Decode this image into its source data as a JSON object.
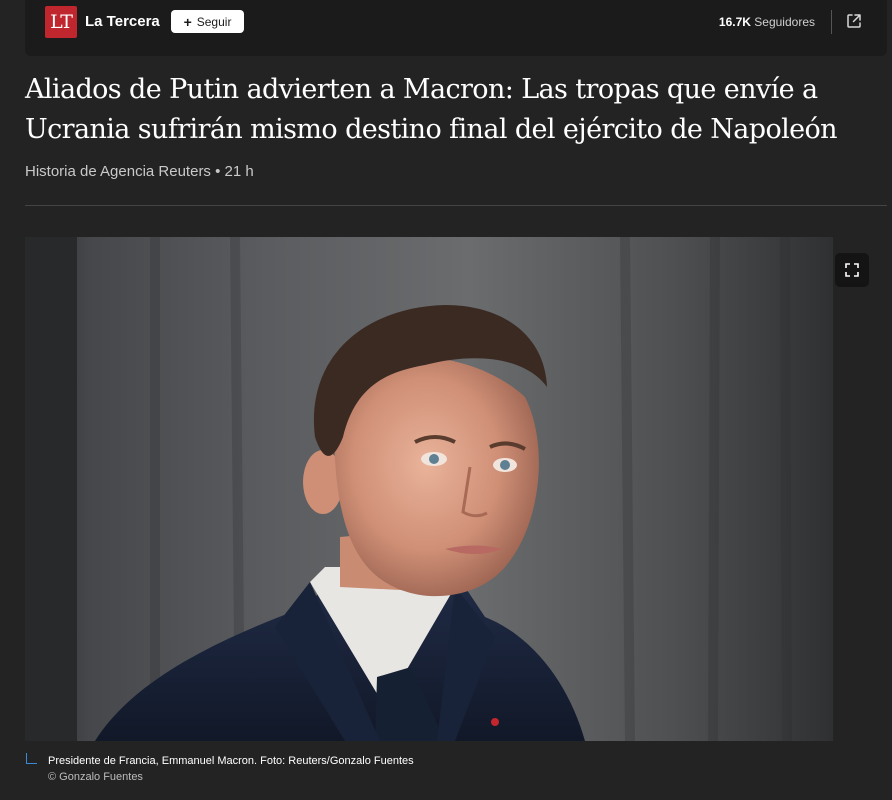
{
  "publisher": {
    "logo_text": "LT",
    "name": "La Tercera",
    "follow_label": "Seguir",
    "followers_count": "16.7K",
    "followers_label": "Seguidores",
    "brand_color": "#c0262d"
  },
  "article": {
    "headline": "Aliados de Putin advierten a Macron: Las tropas que envíe a Ucrania sufrirán mismo destino final del ejército de Napoleón",
    "byline": "Historia de Agencia Reuters • 21 h"
  },
  "image": {
    "caption": "Presidente de Francia, Emmanuel Macron. Foto: Reuters/Gonzalo Fuentes",
    "credit": "© Gonzalo Fuentes"
  },
  "icons": {
    "share": "external-link-icon",
    "expand": "fullscreen-icon",
    "follow": "plus-icon"
  },
  "colors": {
    "background": "#232323",
    "topbar": "#1b1b1b",
    "accent": "#3a8ad6"
  }
}
